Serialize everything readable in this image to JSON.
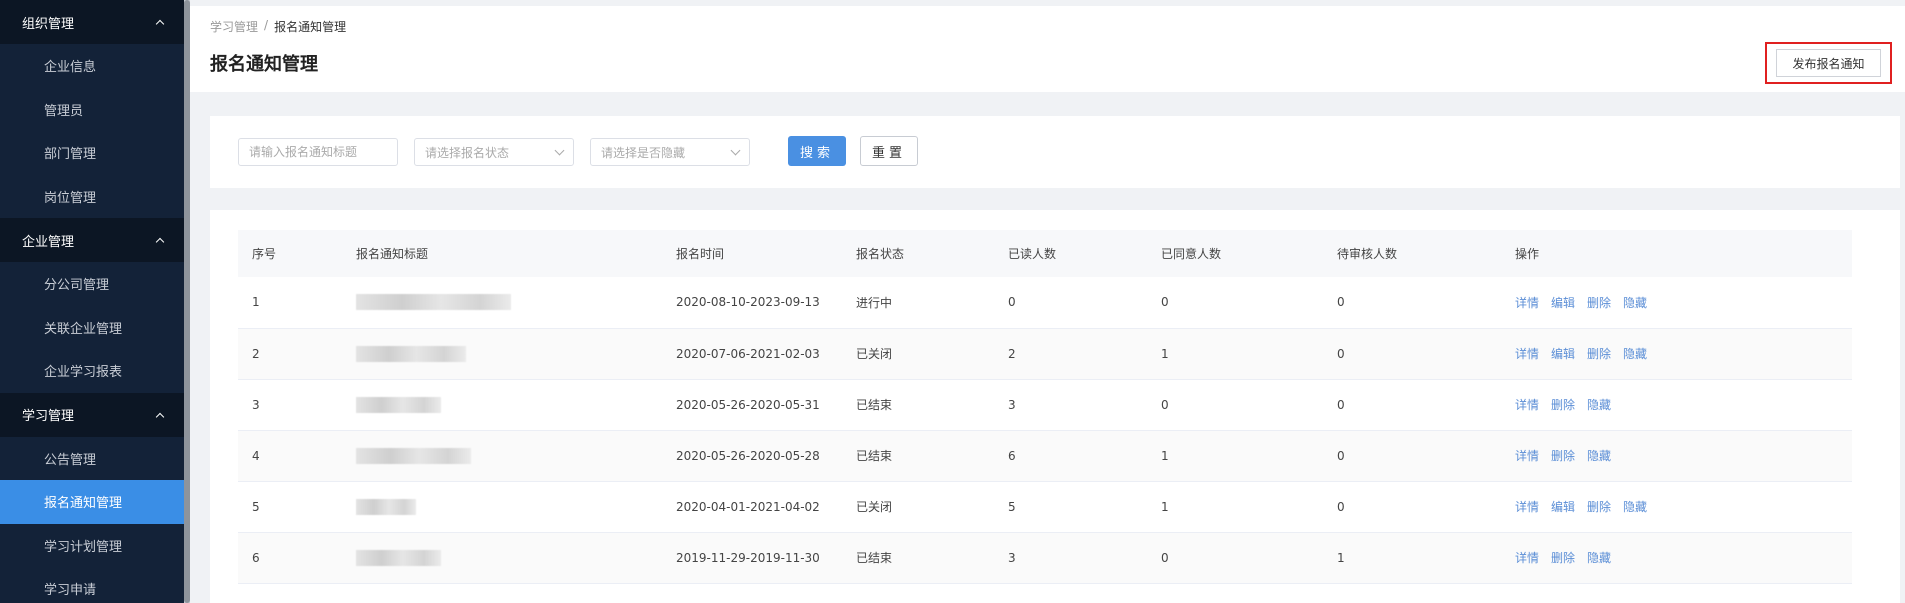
{
  "sidebar": {
    "groups": [
      {
        "title": "组织管理",
        "items": [
          "企业信息",
          "管理员",
          "部门管理",
          "岗位管理"
        ]
      },
      {
        "title": "企业管理",
        "items": [
          "分公司管理",
          "关联企业管理",
          "企业学习报表"
        ]
      },
      {
        "title": "学习管理",
        "items": [
          "公告管理",
          "报名通知管理",
          "学习计划管理",
          "学习申请"
        ]
      }
    ]
  },
  "breadcrumb": {
    "parent": "学习管理",
    "separator": "/",
    "current": "报名通知管理"
  },
  "header": {
    "title": "报名通知管理",
    "publish_label": "发布报名通知"
  },
  "filters": {
    "title_placeholder": "请输入报名通知标题",
    "status_placeholder": "请选择报名状态",
    "hidden_placeholder": "请选择是否隐藏",
    "search_label": "搜索",
    "reset_label": "重置"
  },
  "table": {
    "columns": [
      "序号",
      "报名通知标题",
      "报名时间",
      "报名状态",
      "已读人数",
      "已同意人数",
      "待审核人数",
      "操作"
    ],
    "rows": [
      {
        "index": "1",
        "time": "2020-08-10-2023-09-13",
        "status": "进行中",
        "read": "0",
        "agreed": "0",
        "pending": "0",
        "actions": [
          "详情",
          "编辑",
          "删除",
          "隐藏"
        ]
      },
      {
        "index": "2",
        "time": "2020-07-06-2021-02-03",
        "status": "已关闭",
        "read": "2",
        "agreed": "1",
        "pending": "0",
        "actions": [
          "详情",
          "编辑",
          "删除",
          "隐藏"
        ]
      },
      {
        "index": "3",
        "time": "2020-05-26-2020-05-31",
        "status": "已结束",
        "read": "3",
        "agreed": "0",
        "pending": "0",
        "actions": [
          "详情",
          "删除",
          "隐藏"
        ]
      },
      {
        "index": "4",
        "time": "2020-05-26-2020-05-28",
        "status": "已结束",
        "read": "6",
        "agreed": "1",
        "pending": "0",
        "actions": [
          "详情",
          "删除",
          "隐藏"
        ]
      },
      {
        "index": "5",
        "time": "2020-04-01-2021-04-02",
        "status": "已关闭",
        "read": "5",
        "agreed": "1",
        "pending": "0",
        "actions": [
          "详情",
          "编辑",
          "删除",
          "隐藏"
        ]
      },
      {
        "index": "6",
        "time": "2019-11-29-2019-11-30",
        "status": "已结束",
        "read": "3",
        "agreed": "0",
        "pending": "1",
        "actions": [
          "详情",
          "删除",
          "隐藏"
        ]
      }
    ]
  }
}
